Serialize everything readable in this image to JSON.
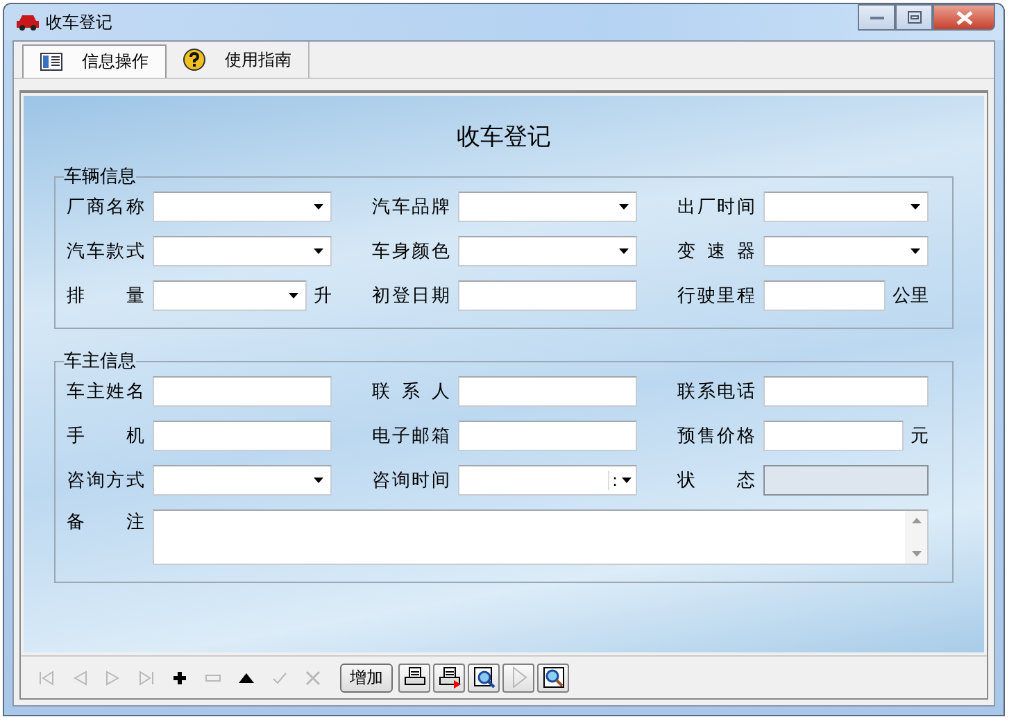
{
  "window": {
    "title": "收车登记"
  },
  "tabs": [
    {
      "label": "信息操作",
      "selected": true
    },
    {
      "label": "使用指南",
      "selected": false
    }
  ],
  "form_title": "收车登记",
  "groups": [
    {
      "legend": "车辆信息",
      "fields": [
        {
          "label": "厂商名称",
          "kind": "select"
        },
        {
          "label": "汽车品牌",
          "kind": "select"
        },
        {
          "label": "出厂时间",
          "kind": "select"
        },
        {
          "label": "汽车款式",
          "kind": "select"
        },
        {
          "label": "车身颜色",
          "kind": "select"
        },
        {
          "label": "变 速 器",
          "kind": "select"
        },
        {
          "label": "排 量",
          "kind": "select",
          "unit": "升"
        },
        {
          "label": "初登日期",
          "kind": "text"
        },
        {
          "label": "行驶里程",
          "kind": "text",
          "unit": "公里"
        }
      ]
    },
    {
      "legend": "车主信息",
      "fields": [
        {
          "label": "车主姓名",
          "kind": "text"
        },
        {
          "label": "联 系 人",
          "kind": "text"
        },
        {
          "label": "联系电话",
          "kind": "text"
        },
        {
          "label": "手 机",
          "kind": "text"
        },
        {
          "label": "电子邮箱",
          "kind": "text"
        },
        {
          "label": "预售价格",
          "kind": "text",
          "unit": "元"
        },
        {
          "label": "咨询方式",
          "kind": "select"
        },
        {
          "label": "咨询时间",
          "kind": "time",
          "separator": ":"
        },
        {
          "label": "状 态",
          "kind": "readonly"
        },
        {
          "label": "备 注",
          "kind": "memo"
        }
      ]
    }
  ],
  "toolbar": [
    {
      "kind": "first",
      "disabled": true
    },
    {
      "kind": "prev",
      "disabled": true
    },
    {
      "kind": "next",
      "disabled": true
    },
    {
      "kind": "last",
      "disabled": true
    },
    {
      "kind": "plus",
      "disabled": false
    },
    {
      "kind": "minus",
      "disabled": true
    },
    {
      "kind": "up",
      "disabled": false
    },
    {
      "kind": "check",
      "disabled": true
    },
    {
      "kind": "cancel",
      "disabled": true
    },
    {
      "kind": "text",
      "label": "增加",
      "disabled": false
    },
    {
      "kind": "print",
      "disabled": false
    },
    {
      "kind": "print-red",
      "disabled": false
    },
    {
      "kind": "preview",
      "disabled": false
    },
    {
      "kind": "play",
      "disabled": true
    },
    {
      "kind": "search",
      "disabled": false
    }
  ]
}
